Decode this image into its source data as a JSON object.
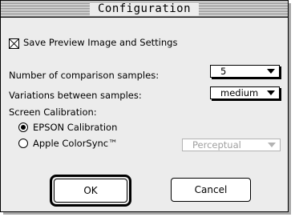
{
  "dialog": {
    "title": "Configuration"
  },
  "save_preview": {
    "label": "Save Preview Image and Settings",
    "checked": true
  },
  "comparison_samples": {
    "label": "Number of comparison samples:",
    "value": "5"
  },
  "variations": {
    "label": "Variations between samples:",
    "value": "medium"
  },
  "calibration": {
    "label": "Screen Calibration:",
    "options": [
      {
        "label": "EPSON Calibration",
        "selected": true
      },
      {
        "label": "Apple ColorSync™",
        "selected": false
      }
    ],
    "colorsync_popup": {
      "value": "Perceptual",
      "enabled": false
    }
  },
  "buttons": {
    "ok": "OK",
    "cancel": "Cancel"
  }
}
